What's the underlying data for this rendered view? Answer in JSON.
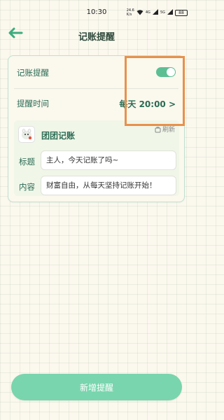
{
  "status_bar": {
    "time": "10:30",
    "net_speed_value": "24.6",
    "net_speed_unit": "K/s",
    "signal_1": "4G",
    "signal_2": "5G",
    "battery": "88"
  },
  "header": {
    "back_icon": "arrow-left-icon",
    "title": "记账提醒"
  },
  "settings": {
    "reminder_label": "记账提醒",
    "reminder_enabled": true,
    "time_label": "提醒时间",
    "time_value": "每天 20:00 >",
    "accent_color": "#5cbf94"
  },
  "preview": {
    "app_name": "团团记账",
    "refresh_icon": "refresh-icon",
    "refresh_label": "刷新",
    "title_label": "标题",
    "title_value": "主人，今天记账了吗~",
    "content_label": "内容",
    "content_value": "财富自由，从每天坚持记账开始！"
  },
  "footer": {
    "add_button_label": "新增提醒"
  },
  "highlight_color": "#e8914c"
}
